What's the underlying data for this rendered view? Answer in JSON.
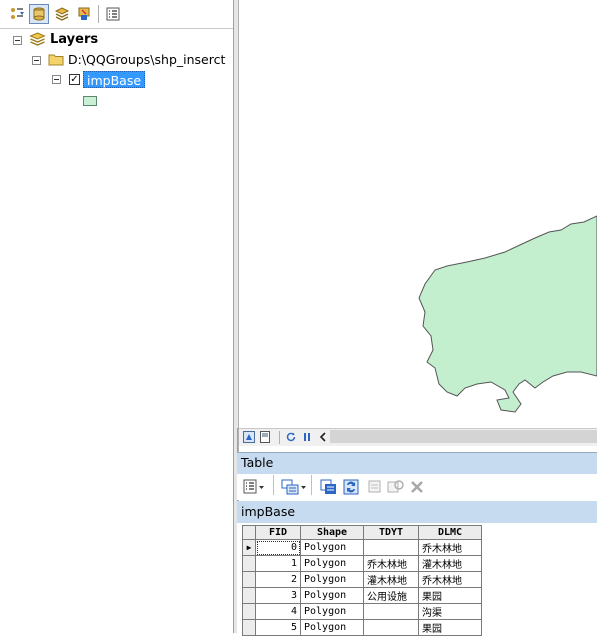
{
  "toc": {
    "toolbar_icons": [
      "list-by-drawing-order-icon",
      "list-by-source-icon",
      "list-by-visibility-icon",
      "list-by-selection-icon",
      "options-icon"
    ],
    "layers_label": "Layers",
    "folder_path": "D:\\QQGroups\\shp_inserct",
    "layer_name": "impBase",
    "layer_checked": "✓",
    "legend_fill_color": "#c9efd6"
  },
  "map": {
    "polygon_fill": "#c3efcf",
    "polygon_stroke": "#555555"
  },
  "map_nav": {
    "icons": [
      "data-view-icon",
      "layout-view-icon",
      "refresh-icon",
      "pause-icon",
      "scroll-left-icon"
    ]
  },
  "table_window": {
    "title": "Table",
    "toolbar_icons": [
      "table-options-icon",
      "related-tables-icon",
      "select-by-attributes-icon",
      "switch-selection-icon",
      "clear-selection-icon",
      "zoom-to-selected-icon",
      "delete-selected-icon"
    ],
    "tab_label": "impBase",
    "columns": [
      "FID",
      "Shape",
      "TDYT",
      "DLMC"
    ],
    "rows": [
      {
        "fid": "0",
        "shape": "Polygon",
        "tdyt": "",
        "dlmc": "乔木林地"
      },
      {
        "fid": "1",
        "shape": "Polygon",
        "tdyt": "乔木林地",
        "dlmc": "灌木林地"
      },
      {
        "fid": "2",
        "shape": "Polygon",
        "tdyt": "灌木林地",
        "dlmc": "乔木林地"
      },
      {
        "fid": "3",
        "shape": "Polygon",
        "tdyt": "公用设施",
        "dlmc": "果园"
      },
      {
        "fid": "4",
        "shape": "Polygon",
        "tdyt": "",
        "dlmc": "沟渠"
      },
      {
        "fid": "5",
        "shape": "Polygon",
        "tdyt": "",
        "dlmc": "果园"
      }
    ]
  }
}
